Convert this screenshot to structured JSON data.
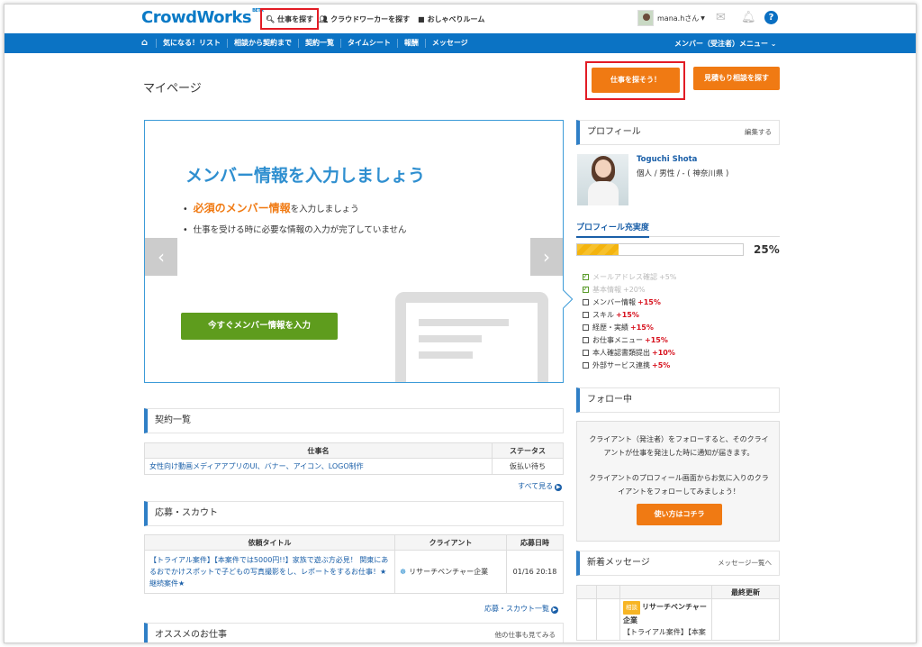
{
  "header": {
    "logo": "CrowdWorks",
    "logo_badge": "BETA",
    "nav_search": "仕事を探す",
    "nav_workers": "クラウドワーカーを探す",
    "nav_room": "おしゃべりルーム",
    "user": "mana.hさん"
  },
  "nav": {
    "items": [
      "気になる！リスト",
      "相談から契約まで",
      "契約一覧",
      "タイムシート",
      "報酬",
      "メッセージ"
    ],
    "menu": "メンバー（受注者）メニュー"
  },
  "page": {
    "title": "マイページ",
    "btn_find": "仕事を探そう！",
    "btn_estimate": "見積もり相談を探す"
  },
  "hero": {
    "title": "メンバー情報を入力しましょう",
    "bullet1_emph": "必須のメンバー情報",
    "bullet1_rest": "を入力しましょう",
    "bullet2": "仕事を受ける時に必要な情報の入力が完了していません",
    "cta": "今すぐメンバー情報を入力"
  },
  "contracts": {
    "title": "契約一覧",
    "col_name": "仕事名",
    "col_status": "ステータス",
    "rows": [
      {
        "name": "女性向け動画メディアアプリのUI、バナー、アイコン、LOGO制作",
        "status": "仮払い待ち"
      }
    ],
    "more": "すべて見る"
  },
  "applications": {
    "title": "応募・スカウト",
    "col_title": "依頼タイトル",
    "col_client": "クライアント",
    "col_date": "応募日時",
    "row_title": "【トライアル案件】【本案件では5000円!!】家族で遊ぶ方必見！ 関東にあるおでかけスポットで子どもの写真撮影をし、レポートをするお仕事！★継続案件★",
    "row_client": "リサーチベンチャー企業",
    "row_date": "01/16 20:18",
    "more": "応募・スカウト一覧"
  },
  "recommend": {
    "title": "オススメのお仕事",
    "more": "他の仕事も見てみる"
  },
  "profile": {
    "title": "プロフィール",
    "edit": "編集する",
    "name": "Toguchi Shota",
    "info": "個人 / 男性 / - ( 神奈川県 )",
    "fill_title": "プロフィール充実度",
    "fill_percent": 25,
    "fill_label": "25%",
    "checks": [
      {
        "label": "メールアドレス確認",
        "pts": "+5%",
        "done": true
      },
      {
        "label": "基本情報",
        "pts": "+20%",
        "done": true
      },
      {
        "label": "メンバー情報",
        "pts": "+15%",
        "done": false
      },
      {
        "label": "スキル",
        "pts": "+15%",
        "done": false
      },
      {
        "label": "経歴・実績",
        "pts": "+15%",
        "done": false
      },
      {
        "label": "お仕事メニュー",
        "pts": "+15%",
        "done": false
      },
      {
        "label": "本人確認書類提出",
        "pts": "+10%",
        "done": false
      },
      {
        "label": "外部サービス連携",
        "pts": "+5%",
        "done": false
      }
    ]
  },
  "follow": {
    "title": "フォロー中",
    "text1": "クライアント（発注者）をフォローすると、そのクライアントが仕事を発注した時に通知が届きます。",
    "text2": "クライアントのプロフィール画面からお気に入りのクライアントをフォローしてみましょう！",
    "btn": "使い方はコチラ"
  },
  "messages": {
    "title": "新着メッセージ",
    "link": "メッセージ一覧へ",
    "col_last": "最終更新",
    "tag": "相談",
    "sender": "リサーチベンチャー企業",
    "preview": "【トライアル案件】【本案"
  }
}
